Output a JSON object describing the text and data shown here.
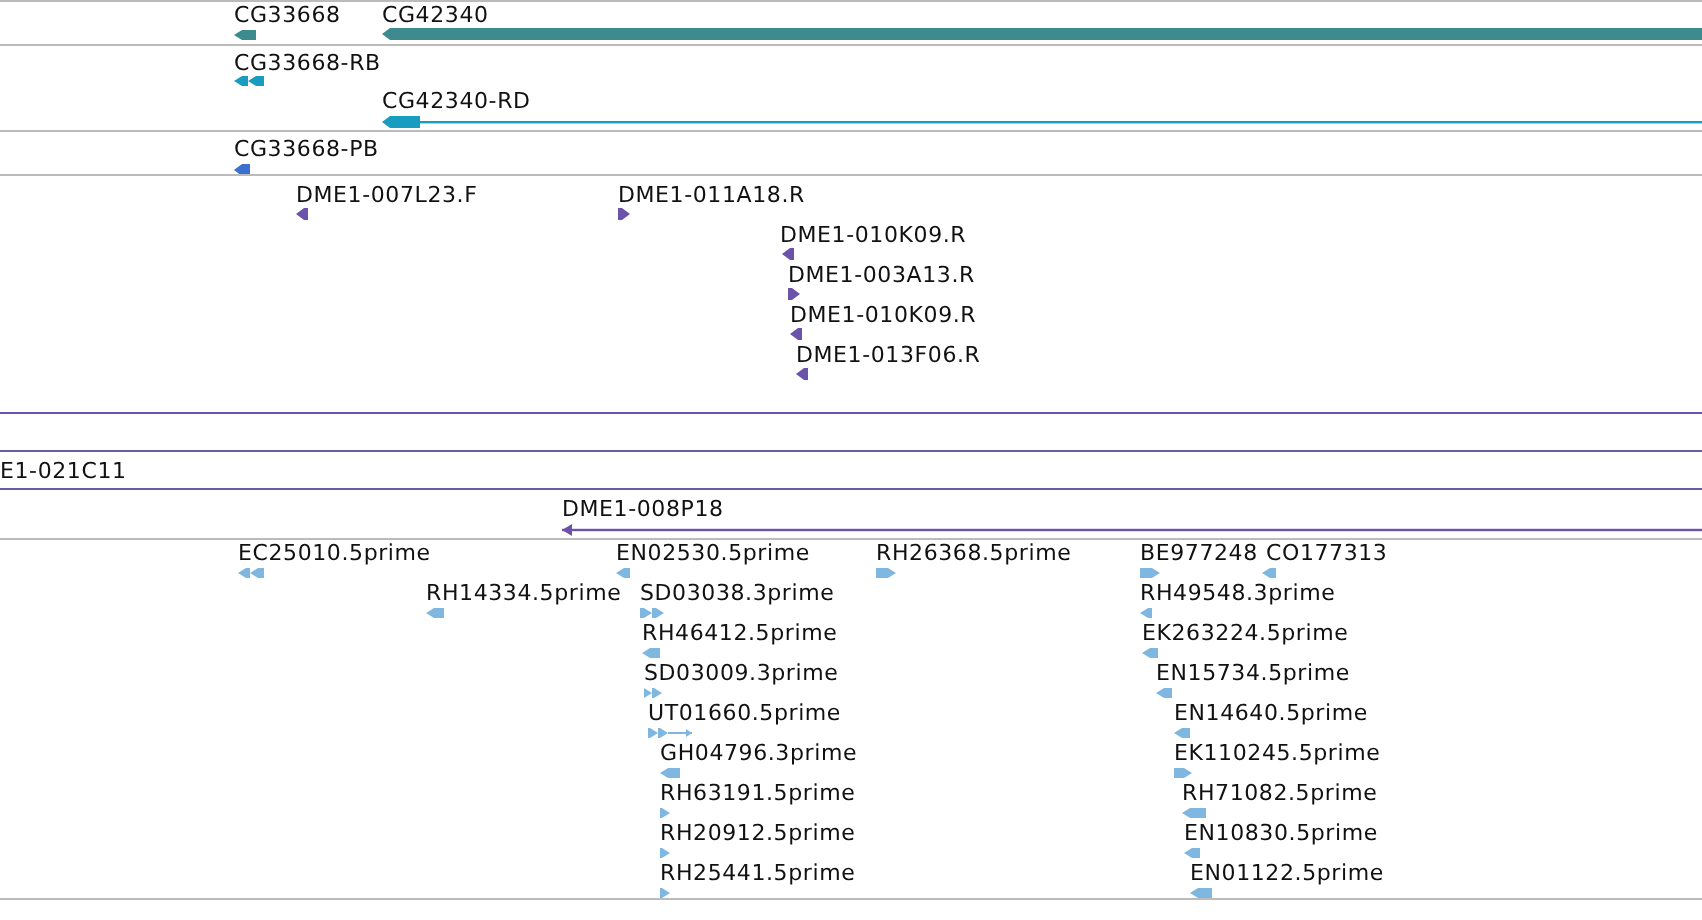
{
  "tracks": [
    {
      "color": "#3d8b8f",
      "features": [
        {
          "label": "CG33668",
          "reverse": true
        },
        {
          "label": "CG42340",
          "reverse": true
        }
      ]
    },
    {
      "color": "#189cc0",
      "features": [
        {
          "label": "CG33668-RB",
          "reverse": true
        },
        {
          "label": "CG42340-RD",
          "reverse": true
        }
      ]
    },
    {
      "color": "#3b6fd0",
      "features": [
        {
          "label": "CG33668-PB",
          "reverse": true
        }
      ]
    },
    {
      "color": "#6b52aa",
      "features": [
        {
          "label": "DME1-007L23.F",
          "reverse": true
        },
        {
          "label": "DME1-011A18.R",
          "reverse": false
        },
        {
          "label": "DME1-010K09.R",
          "reverse": true
        },
        {
          "label": "DME1-003A13.R",
          "reverse": false
        },
        {
          "label": "DME1-010K09.R",
          "reverse": true
        },
        {
          "label": "DME1-013F06.R",
          "reverse": true
        }
      ]
    },
    {
      "color": "#6b5ba8"
    },
    {
      "color": "#6b5ba8",
      "features": [
        {
          "label": "E1-021C11"
        }
      ]
    },
    {
      "color": "#6b52aa",
      "features": [
        {
          "label": "DME1-008P18",
          "reverse": true
        }
      ]
    },
    {
      "color": "#7fb7e0",
      "features": [
        {
          "label": "EC25010.5prime",
          "reverse": true
        },
        {
          "label": "EN02530.5prime",
          "reverse": true
        },
        {
          "label": "RH26368.5prime",
          "reverse": false
        },
        {
          "label": "BE977248",
          "reverse": false
        },
        {
          "label": "CO177313",
          "reverse": true
        },
        {
          "label": "RH14334.5prime",
          "reverse": true
        },
        {
          "label": "SD03038.3prime",
          "reverse": false
        },
        {
          "label": "RH49548.3prime",
          "reverse": true
        },
        {
          "label": "RH46412.5prime",
          "reverse": true
        },
        {
          "label": "EK263224.5prime",
          "reverse": true
        },
        {
          "label": "SD03009.3prime",
          "reverse": false
        },
        {
          "label": "EN15734.5prime",
          "reverse": true
        },
        {
          "label": "UT01660.5prime",
          "reverse": false
        },
        {
          "label": "EN14640.5prime",
          "reverse": true
        },
        {
          "label": "GH04796.3prime",
          "reverse": true
        },
        {
          "label": "EK110245.5prime",
          "reverse": false
        },
        {
          "label": "RH63191.5prime",
          "reverse": false
        },
        {
          "label": "RH71082.5prime",
          "reverse": true
        },
        {
          "label": "RH20912.5prime",
          "reverse": false
        },
        {
          "label": "EN10830.5prime",
          "reverse": true
        },
        {
          "label": "RH25441.5prime",
          "reverse": false
        },
        {
          "label": "EN01122.5prime",
          "reverse": true
        }
      ]
    }
  ]
}
